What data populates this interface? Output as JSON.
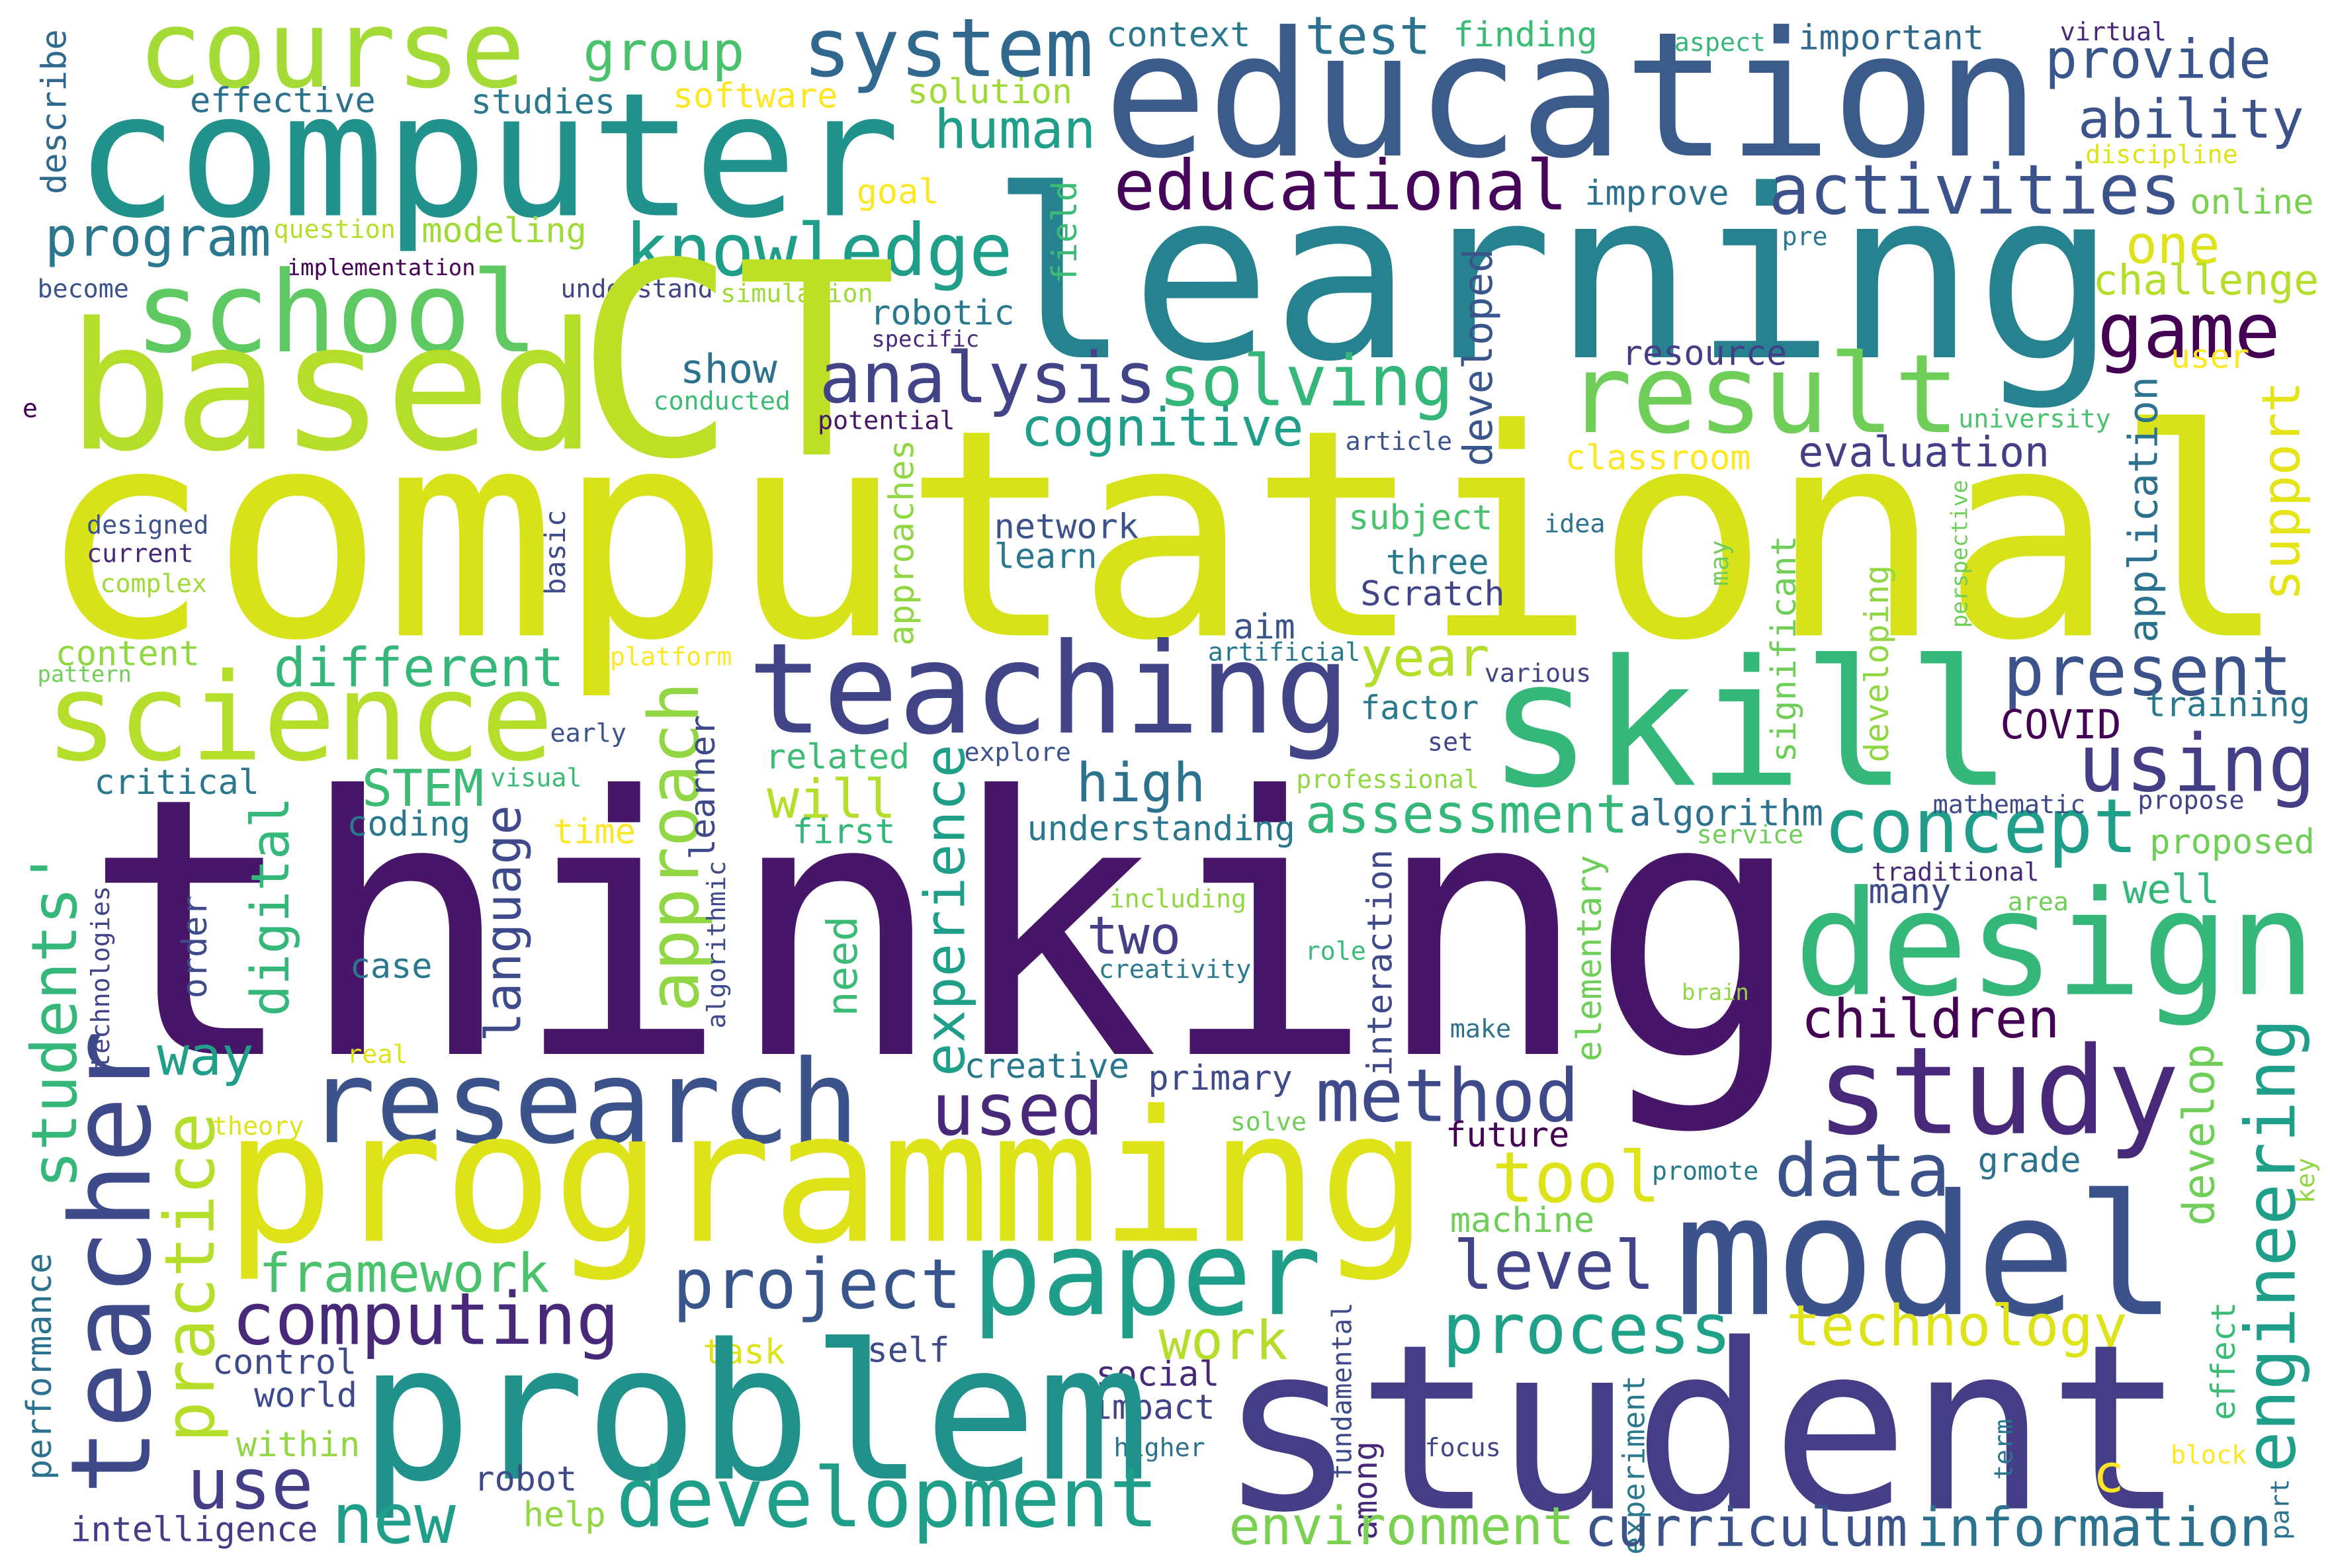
{
  "words": [
    {
      "text": "computational",
      "color": "#d8e219"
    },
    {
      "text": "thinking",
      "color": "#481668"
    },
    {
      "text": "learning",
      "color": "#26828e"
    },
    {
      "text": "course",
      "color": "#a5db36"
    },
    {
      "text": "computer",
      "color": "#21918c"
    },
    {
      "text": "education",
      "color": "#3b5b8b"
    },
    {
      "text": "system",
      "color": "#31688e"
    },
    {
      "text": "group",
      "color": "#4ac16d"
    },
    {
      "text": "test",
      "color": "#2c728e"
    },
    {
      "text": "context",
      "color": "#2a788e"
    },
    {
      "text": "finding",
      "color": "#3bbb75"
    },
    {
      "text": "aspect",
      "color": "#35b779"
    },
    {
      "text": "important",
      "color": "#31688e"
    },
    {
      "text": "virtual",
      "color": "#482878"
    },
    {
      "text": "provide",
      "color": "#39568c"
    },
    {
      "text": "ability",
      "color": "#3b528b"
    },
    {
      "text": "discipline",
      "color": "#dde318"
    },
    {
      "text": "online",
      "color": "#7ad151"
    },
    {
      "text": "effective",
      "color": "#2c728e"
    },
    {
      "text": "studies",
      "color": "#2a788e"
    },
    {
      "text": "software",
      "color": "#fde725"
    },
    {
      "text": "solution",
      "color": "#a0da39"
    },
    {
      "text": "describe",
      "color": "#31688e"
    },
    {
      "text": "human",
      "color": "#1f9e89"
    },
    {
      "text": "educational",
      "color": "#450559"
    },
    {
      "text": "improve",
      "color": "#2c728e"
    },
    {
      "text": "activities",
      "color": "#3b528b"
    },
    {
      "text": "program",
      "color": "#2a788e"
    },
    {
      "text": "question",
      "color": "#b5de2b"
    },
    {
      "text": "modeling",
      "color": "#a0da39"
    },
    {
      "text": "implementation",
      "color": "#440154"
    },
    {
      "text": "become",
      "color": "#3b528b"
    },
    {
      "text": "understand",
      "color": "#414487"
    },
    {
      "text": "simulation",
      "color": "#a0da39"
    },
    {
      "text": "school",
      "color": "#5ec962"
    },
    {
      "text": "knowledge",
      "color": "#1f9e89"
    },
    {
      "text": "goal",
      "color": "#fde725"
    },
    {
      "text": "field",
      "color": "#3bbb75"
    },
    {
      "text": "pre",
      "color": "#2a788e"
    },
    {
      "text": "one",
      "color": "#dde318"
    },
    {
      "text": "challenge",
      "color": "#b5de2b"
    },
    {
      "text": "game",
      "color": "#440154"
    },
    {
      "text": "user",
      "color": "#fde725"
    },
    {
      "text": "robotic",
      "color": "#2a788e"
    },
    {
      "text": "specific",
      "color": "#482878"
    },
    {
      "text": "based",
      "color": "#b5de2b"
    },
    {
      "text": "CT",
      "color": "#bddf26"
    },
    {
      "text": "analysis",
      "color": "#414487"
    },
    {
      "text": "solving",
      "color": "#35b779"
    },
    {
      "text": "result",
      "color": "#6ece58"
    },
    {
      "text": "resource",
      "color": "#433e85"
    },
    {
      "text": "show",
      "color": "#2c728e"
    },
    {
      "text": "conducted",
      "color": "#3bbb75"
    },
    {
      "text": "potential",
      "color": "#481668"
    },
    {
      "text": "university",
      "color": "#4ac16d"
    },
    {
      "text": "e",
      "color": "#440154"
    },
    {
      "text": "developed",
      "color": "#39568c"
    },
    {
      "text": "application",
      "color": "#2c728e"
    },
    {
      "text": "support",
      "color": "#e5e419"
    },
    {
      "text": "cognitive",
      "color": "#1f9e89"
    },
    {
      "text": "article",
      "color": "#3b528b"
    },
    {
      "text": "evaluation",
      "color": "#433e85"
    },
    {
      "text": "classroom",
      "color": "#fde725"
    },
    {
      "text": "approaches",
      "color": "#90d743"
    },
    {
      "text": "designed",
      "color": "#3b528b"
    },
    {
      "text": "current",
      "color": "#482878"
    },
    {
      "text": "complex",
      "color": "#a0da39"
    },
    {
      "text": "basic",
      "color": "#3e4a89"
    },
    {
      "text": "network",
      "color": "#3b528b"
    },
    {
      "text": "learn",
      "color": "#2a788e"
    },
    {
      "text": "subject",
      "color": "#4ac16d"
    },
    {
      "text": "idea",
      "color": "#2c728e"
    },
    {
      "text": "three",
      "color": "#2a788e"
    },
    {
      "text": "Scratch",
      "color": "#414487"
    },
    {
      "text": "may",
      "color": "#6ece58"
    },
    {
      "text": "significant",
      "color": "#6ece58"
    },
    {
      "text": "developing",
      "color": "#90d743"
    },
    {
      "text": "perspective",
      "color": "#6ece58"
    },
    {
      "text": "aim",
      "color": "#3b528b"
    },
    {
      "text": "artificial",
      "color": "#2a788e"
    },
    {
      "text": "year",
      "color": "#b5de2b"
    },
    {
      "text": "various",
      "color": "#414487"
    },
    {
      "text": "content",
      "color": "#90d743"
    },
    {
      "text": "pattern",
      "color": "#6ece58"
    },
    {
      "text": "platform",
      "color": "#fde725"
    },
    {
      "text": "different",
      "color": "#35b779"
    },
    {
      "text": "science",
      "color": "#b5de2b"
    },
    {
      "text": "teaching",
      "color": "#414487"
    },
    {
      "text": "skill",
      "color": "#35b779"
    },
    {
      "text": "present",
      "color": "#3b528b"
    },
    {
      "text": "training",
      "color": "#2a788e"
    },
    {
      "text": "COVID",
      "color": "#440154"
    },
    {
      "text": "using",
      "color": "#433e85"
    },
    {
      "text": "factor",
      "color": "#2a788e"
    },
    {
      "text": "set",
      "color": "#414487"
    },
    {
      "text": "approach",
      "color": "#90d743"
    },
    {
      "text": "early",
      "color": "#3b528b"
    },
    {
      "text": "learner",
      "color": "#3e4a89"
    },
    {
      "text": "algorithmic",
      "color": "#3e4a89"
    },
    {
      "text": "related",
      "color": "#3bbb75"
    },
    {
      "text": "explore",
      "color": "#3b528b"
    },
    {
      "text": "experience",
      "color": "#1f9e89"
    },
    {
      "text": "professional",
      "color": "#90d743"
    },
    {
      "text": "critical",
      "color": "#2a788e"
    },
    {
      "text": "STEM",
      "color": "#3bbb75"
    },
    {
      "text": "visual",
      "color": "#3bbb75"
    },
    {
      "text": "will",
      "color": "#b5de2b"
    },
    {
      "text": "high",
      "color": "#2c728e"
    },
    {
      "text": "assessment",
      "color": "#35b779"
    },
    {
      "text": "algorithm",
      "color": "#2c728e"
    },
    {
      "text": "concept",
      "color": "#1f9e89"
    },
    {
      "text": "mathematic",
      "color": "#3e4a89"
    },
    {
      "text": "propose",
      "color": "#414487"
    },
    {
      "text": "service",
      "color": "#6ece58"
    },
    {
      "text": "proposed",
      "color": "#6ece58"
    },
    {
      "text": "traditional",
      "color": "#482878"
    },
    {
      "text": "many",
      "color": "#3e4a89"
    },
    {
      "text": "area",
      "color": "#6ece58"
    },
    {
      "text": "well",
      "color": "#35b779"
    },
    {
      "text": "coding",
      "color": "#2a788e"
    },
    {
      "text": "time",
      "color": "#fde725"
    },
    {
      "text": "first",
      "color": "#35b779"
    },
    {
      "text": "understanding",
      "color": "#2a788e"
    },
    {
      "text": "students'",
      "color": "#35b779"
    },
    {
      "text": "digital",
      "color": "#35b779"
    },
    {
      "text": "language",
      "color": "#3e4a89"
    },
    {
      "text": "technologies",
      "color": "#414487"
    },
    {
      "text": "order",
      "color": "#3e4a89"
    },
    {
      "text": "case",
      "color": "#2a788e"
    },
    {
      "text": "need",
      "color": "#3bbb75"
    },
    {
      "text": "including",
      "color": "#90d743"
    },
    {
      "text": "two",
      "color": "#433e85"
    },
    {
      "text": "creativity",
      "color": "#2a788e"
    },
    {
      "text": "role",
      "color": "#3bbb75"
    },
    {
      "text": "interaction",
      "color": "#3e4a89"
    },
    {
      "text": "elementary",
      "color": "#6ece58"
    },
    {
      "text": "brain",
      "color": "#90d743"
    },
    {
      "text": "design",
      "color": "#35b779"
    },
    {
      "text": "children",
      "color": "#440154"
    },
    {
      "text": "make",
      "color": "#2c728e"
    },
    {
      "text": "way",
      "color": "#1f9e89"
    },
    {
      "text": "real",
      "color": "#dde318"
    },
    {
      "text": "teacher",
      "color": "#3e4a89"
    },
    {
      "text": "research",
      "color": "#3b528b"
    },
    {
      "text": "practice",
      "color": "#b5de2b"
    },
    {
      "text": "theory",
      "color": "#dde318"
    },
    {
      "text": "creative",
      "color": "#2a788e"
    },
    {
      "text": "used",
      "color": "#482878"
    },
    {
      "text": "primary",
      "color": "#3e4a89"
    },
    {
      "text": "solve",
      "color": "#6ece58"
    },
    {
      "text": "method",
      "color": "#3e4a89"
    },
    {
      "text": "future",
      "color": "#440154"
    },
    {
      "text": "study",
      "color": "#482878"
    },
    {
      "text": "programming",
      "color": "#dde318"
    },
    {
      "text": "tool",
      "color": "#dde318"
    },
    {
      "text": "promote",
      "color": "#2a788e"
    },
    {
      "text": "data",
      "color": "#3b528b"
    },
    {
      "text": "grade",
      "color": "#2c728e"
    },
    {
      "text": "develop",
      "color": "#6ece58"
    },
    {
      "text": "engineering",
      "color": "#1f9e89"
    },
    {
      "text": "key",
      "color": "#90d743"
    },
    {
      "text": "model",
      "color": "#3b528b"
    },
    {
      "text": "machine",
      "color": "#6ece58"
    },
    {
      "text": "level",
      "color": "#414487"
    },
    {
      "text": "performance",
      "color": "#2c728e"
    },
    {
      "text": "framework",
      "color": "#4ac16d"
    },
    {
      "text": "project",
      "color": "#39568c"
    },
    {
      "text": "paper",
      "color": "#1f9e89"
    },
    {
      "text": "computing",
      "color": "#482878"
    },
    {
      "text": "process",
      "color": "#1fa187"
    },
    {
      "text": "technology",
      "color": "#dde318"
    },
    {
      "text": "effect",
      "color": "#3bbb75"
    },
    {
      "text": "work",
      "color": "#b5de2b"
    },
    {
      "text": "task",
      "color": "#dde318"
    },
    {
      "text": "self",
      "color": "#3e4a89"
    },
    {
      "text": "control",
      "color": "#3e4a89"
    },
    {
      "text": "world",
      "color": "#3e4a89"
    },
    {
      "text": "social",
      "color": "#482878"
    },
    {
      "text": "impact",
      "color": "#414487"
    },
    {
      "text": "higher",
      "color": "#2c728e"
    },
    {
      "text": "problem",
      "color": "#21918c"
    },
    {
      "text": "student",
      "color": "#433e85"
    },
    {
      "text": "within",
      "color": "#90d743"
    },
    {
      "text": "fundamental",
      "color": "#3e4a89"
    },
    {
      "text": "among",
      "color": "#482878"
    },
    {
      "text": "focus",
      "color": "#414487"
    },
    {
      "text": "experiment",
      "color": "#2a788e"
    },
    {
      "text": "term",
      "color": "#2a788e"
    },
    {
      "text": "c",
      "color": "#fde725"
    },
    {
      "text": "block",
      "color": "#fde725"
    },
    {
      "text": "part",
      "color": "#2c728e"
    },
    {
      "text": "use",
      "color": "#433e85"
    },
    {
      "text": "robot",
      "color": "#3e4a89"
    },
    {
      "text": "help",
      "color": "#90d743"
    },
    {
      "text": "new",
      "color": "#1f9e89"
    },
    {
      "text": "intelligence",
      "color": "#433e85"
    },
    {
      "text": "development",
      "color": "#1f9e89"
    },
    {
      "text": "environment",
      "color": "#7ad151"
    },
    {
      "text": "curriculum",
      "color": "#3b528b"
    },
    {
      "text": "information",
      "color": "#2c728e"
    }
  ]
}
